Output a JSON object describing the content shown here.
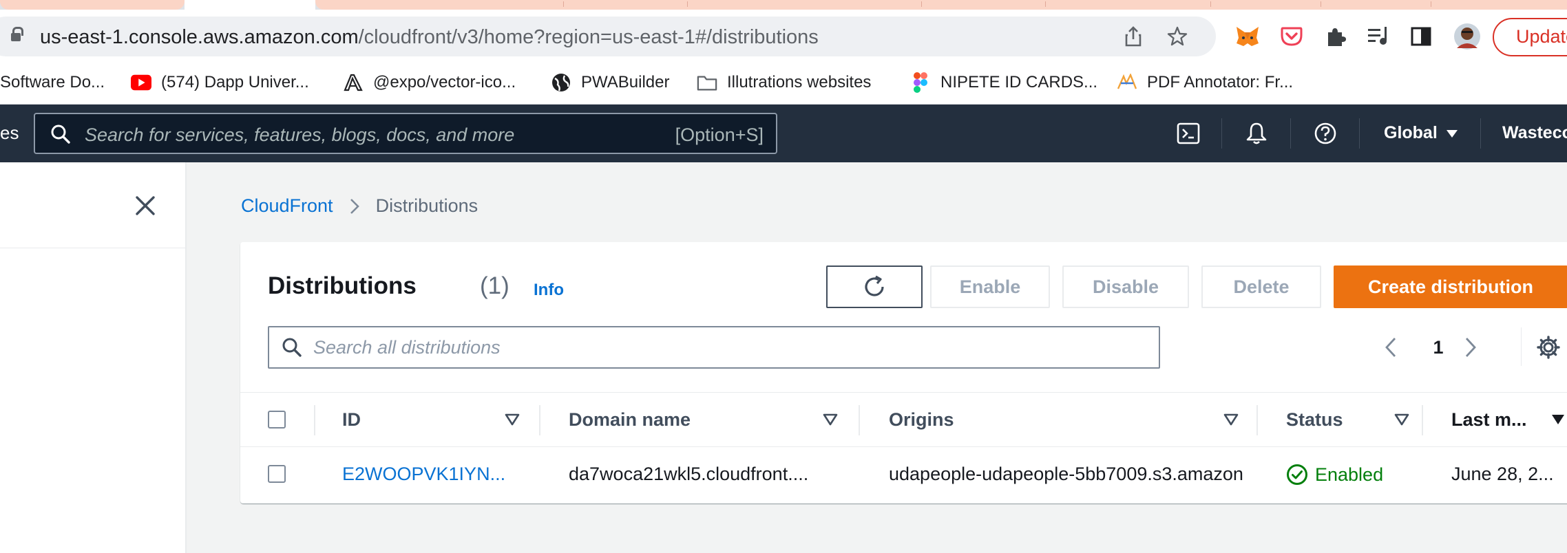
{
  "browser": {
    "url_host": "us-east-1.console.aws.amazon.com",
    "url_path": "/cloudfront/v3/home?region=us-east-1#/distributions",
    "update_label": "Update"
  },
  "bookmarks": [
    {
      "label": "Software Do...",
      "icon": "doc-icon"
    },
    {
      "label": "(574) Dapp Univer...",
      "icon": "youtube-icon"
    },
    {
      "label": "@expo/vector-ico...",
      "icon": "expo-icon"
    },
    {
      "label": "PWABuilder",
      "icon": "globe-icon"
    },
    {
      "label": "Illutrations websites",
      "icon": "folder-icon"
    },
    {
      "label": "NIPETE ID CARDS...",
      "icon": "figma-icon"
    },
    {
      "label": "PDF Annotator: Fr...",
      "icon": "pdf-annotator-icon"
    }
  ],
  "aws_header": {
    "services_fragment": "es",
    "search_placeholder": "Search for services, features, blogs, docs, and more",
    "search_shortcut": "[Option+S]",
    "region": "Global",
    "account": "Wastecol"
  },
  "breadcrumb": {
    "parent": "CloudFront",
    "current": "Distributions"
  },
  "distributions": {
    "title": "Distributions",
    "count": "(1)",
    "info_label": "Info",
    "buttons": {
      "enable": "Enable",
      "disable": "Disable",
      "delete": "Delete",
      "create": "Create distribution"
    },
    "filter_placeholder": "Search all distributions",
    "page": "1",
    "columns": [
      "ID",
      "Domain name",
      "Origins",
      "Status",
      "Last m..."
    ],
    "rows": [
      {
        "id": "E2WOOPVK1IYN...",
        "domain": "da7woca21wkl5.cloudfront....",
        "origins": "udapeople-udapeople-5bb7009.s3.amazon",
        "status": "Enabled",
        "last_modified": "June 28, 2..."
      }
    ]
  },
  "colors": {
    "aws_nav": "#232f3e",
    "primary_button": "#ec7211",
    "link": "#0972d3",
    "status_enabled": "#037f0c"
  }
}
